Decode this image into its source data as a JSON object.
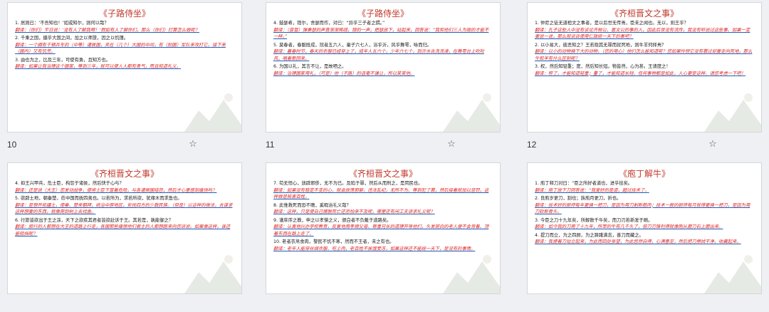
{
  "slides": [
    {
      "number": "10",
      "title": "《子路侍坐》",
      "lines": [
        {
          "t": "q",
          "text": "1. 居则曰：‘不吾知也！’如或知尔，则何以哉？"
        },
        {
          "t": "a",
          "text": "翻译：（你们）平日说：‘没有人了解我啊！’假如有人了解你们，那么（你们）打算怎么做呢？"
        },
        {
          "t": "q",
          "text": "2. 千乘之国，摄乎大国之间，加之以师旅，因之以饥馑。"
        },
        {
          "t": "a",
          "text": "翻译：一个拥有千辆兵车的（中等）诸侯国，夹在（几个）大国的中间，有（别国）军队来攻打它，接下来（国内）又有饥荒。"
        },
        {
          "t": "q",
          "text": "3. 由也为之，比及三年，可使有勇，且知方也。"
        },
        {
          "t": "a",
          "text": "翻译：如果让我治理这个国家，等到三年，就可以使人人都有勇气，而且知道礼义。"
        }
      ]
    },
    {
      "number": "11",
      "title": "《子路侍坐》",
      "lines": [
        {
          "t": "q",
          "text": "4. 鼓瑟希，铿尔，舍瑟而作，对曰：“异乎三子者之撰。”"
        },
        {
          "t": "a",
          "text": "翻译：（曾皙）弹奏瑟的声音渐渐稀疏，铿的一声，把瑟放下，站起来，回答说：“我和他们三人为政的才能不一样。”"
        },
        {
          "t": "q",
          "text": "5. 莫春者，春服既成，冠者五六人，童子六七人，浴乎沂，风乎舞雩，咏而归。"
        },
        {
          "t": "a",
          "text": "翻译：暮春时节，春天的衣服已经穿上了，成年人五六个，少年六七个，到沂水去洗洗澡，在舞雩台上吹吹风，唱着歌回来。"
        },
        {
          "t": "q",
          "text": "6. 为国以礼，其言不让，是故哂之。"
        },
        {
          "t": "a",
          "text": "翻译：治理国家用礼，（可是）他（子路）的话毫不谦让，所以笑笑他。"
        }
      ]
    },
    {
      "number": "12",
      "title": "《齐桓晋文之事》",
      "lines": [
        {
          "t": "q",
          "text": "1. 仲尼之徒无道桓文之事者，是以后世无传焉，臣未之闻也。无以，则王乎？"
        },
        {
          "t": "a",
          "text": "翻译：孔子这些人中没有谈论齐桓公、晋文公的事的人，因此后世没有流传，我没有听说过这些事。如果一定要说一说，那么就谈谈使用仁政统一天下的事吧？"
        },
        {
          "t": "q",
          "text": "2. 以小易大，彼恶知之？王若隐其无罪而就死地，则牛羊何择焉？"
        },
        {
          "t": "a",
          "text": "翻译：以小的动物换下大的动物，（您的用心）他们怎么能知道呢？您如果怜悯它没有罪过却要走向死地，那么牛和羊有什么区别呢？"
        },
        {
          "t": "q",
          "text": "3. 权，然后知轻重；度，然后知长短。物皆然，心为甚。王请度之！"
        },
        {
          "t": "a",
          "text": "翻译：称了，才能知道轻重；量了，才能知道长短。任何事物都是如此，人心更是这样。请您考虑一下吧！"
        }
      ]
    },
    {
      "number": "",
      "title": "《齐桓晋文之事》",
      "lines": [
        {
          "t": "q",
          "text": "4. 抑王兴甲兵，危士臣，构怨于诸侯，然后快于心与？"
        },
        {
          "t": "a",
          "text": "翻译：还是说（大王）您发动战争，使将士臣下冒着危险，与各诸侯国结怨，然后才心里感到痛快吗？"
        },
        {
          "t": "q",
          "text": "5. 欲辟土地，朝秦楚，莅中国而抚四夷也。以若所为，求若所欲，犹缘木而求鱼也。"
        },
        {
          "t": "a",
          "text": "翻译：是想开拓疆土，使秦、楚来朝拜，统治中原地区，安抚四方的少数民族。（但是）以这样的做法，去谋求这样想要的东西，就像爬到树上去找鱼。"
        },
        {
          "t": "q",
          "text": "6. 行旅皆欲出于王之涂，天下之欲疾其君者皆欲赴诉于王。其若是，孰能御之？"
        },
        {
          "t": "a",
          "text": "翻译：旅行的人都想在大王的道路上行走，各国那些痛恨他们君主的人都想跑来向您诉说。如果像这样，谁还能阻挡呢？"
        }
      ]
    },
    {
      "number": "",
      "title": "《齐桓晋文之事》",
      "lines": [
        {
          "t": "q",
          "text": "7. 苟无恒心，放辟邪侈，无不为已。及陷于罪，然后从而刑之，是罔民也。"
        },
        {
          "t": "a",
          "text": "翻译：如果没有稳定不变的心，就会放荡邪僻，违法乱纪，无所不为。等到犯了罪，然后接着就加以惩罚，这样做是陷害百姓。"
        },
        {
          "t": "q",
          "text": "8. 此惟救死而恐不赡，奚暇治礼义哉？"
        },
        {
          "t": "a",
          "text": "翻译：这样，只是使自己摆脱死亡还恐怕来不及呢，哪里还有闲工夫讲求礼义呢？"
        },
        {
          "t": "q",
          "text": "9. 谨庠序之教，申之以孝悌之义，颁白者不负戴于道路矣。"
        },
        {
          "t": "a",
          "text": "翻译：认真地兴办学校教育，反复地用孝顺父母、尊重兄长的道理开导他们，头发斑白的老人便不会背着、顶着东西在路上走了。"
        },
        {
          "t": "q",
          "text": "10. 老者衣帛食肉，黎民不饥不寒，然而不王者，未之有也。"
        },
        {
          "t": "a",
          "text": "翻译：老年人能穿丝绸衣服、吃上肉，老百姓不挨饿受冻，如果这样还不能统一天下，是没有的事情。"
        }
      ]
    },
    {
      "number": "",
      "title": "《庖丁解牛》",
      "lines": [
        {
          "t": "q",
          "text": "1. 庖丁释刀对曰：“臣之所好者道也，进乎技矣。"
        },
        {
          "t": "a",
          "text": "翻译：庖丁放下刀回答说：“我爱好的是道，超过技术了。"
        },
        {
          "t": "q",
          "text": "2. 良庖岁更刀，割也；族庖月更刀，折也。"
        },
        {
          "t": "a",
          "text": "翻译：技术好的厨师每年更换一把刀，是因为用刀割断筋肉；技术一般的厨师每月就得更换一把刀，是因为用刀砍断骨头。"
        },
        {
          "t": "q",
          "text": "3. 今臣之刀十九年矣，所解数千牛矣，而刀刃若新发于硎。"
        },
        {
          "t": "a",
          "text": "翻译：如今我的刀用了十九年，所宰的牛有几千头了，但刀刃锋利得就像刚从磨刀石上磨出来。"
        },
        {
          "t": "q",
          "text": "4. 提刀而立，为之四顾，为之踌躇满志，善刀而藏之。"
        },
        {
          "t": "a",
          "text": "翻译：我提着刀站立起来，为此而四处张望，为此悠然自得，心满意足，然后把刀擦拭干净，收藏起来。"
        }
      ]
    }
  ],
  "star_icon": "star-outline-icon",
  "colors": {
    "title": "#c0392b",
    "answer": "#e02020",
    "highlight_q": "#f3ef3a",
    "highlight_a": "#8fe0f0"
  }
}
